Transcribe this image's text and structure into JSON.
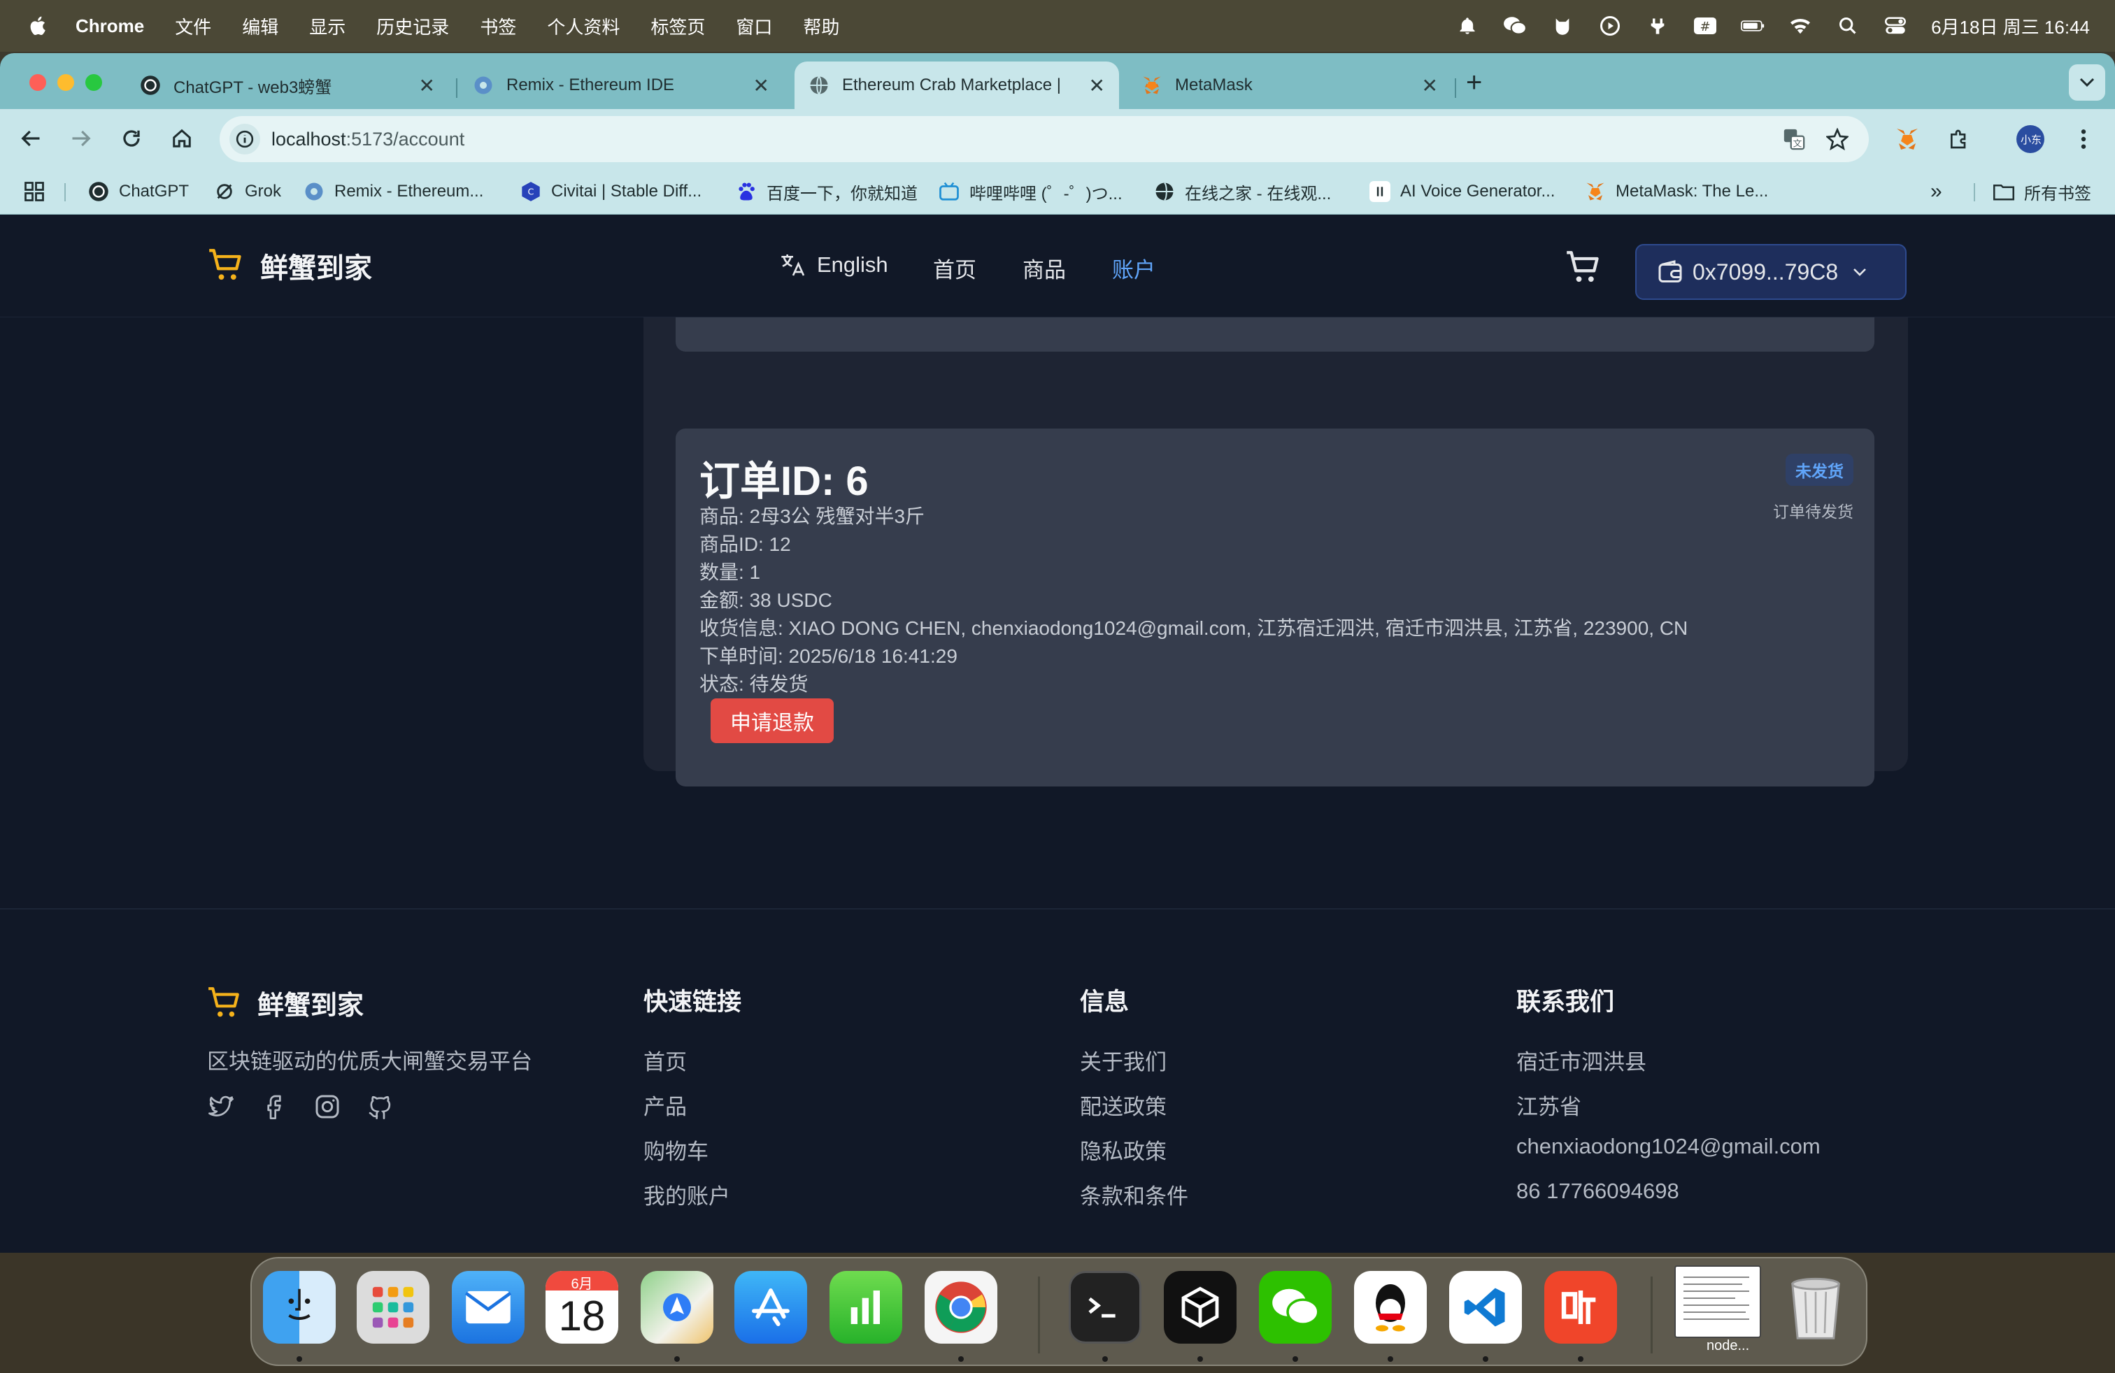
{
  "menubar": {
    "app": "Chrome",
    "items": [
      "文件",
      "编辑",
      "显示",
      "历史记录",
      "书签",
      "个人资料",
      "标签页",
      "窗口",
      "帮助"
    ],
    "status_icons": [
      "bell-icon",
      "wechat-icon",
      "cat-icon",
      "play-circle-icon",
      "fork-icon",
      "hash-icon",
      "battery-icon",
      "wifi-icon",
      "search-icon",
      "control-center-icon"
    ],
    "clock": "6月18日 周三 16:44"
  },
  "tabs": [
    {
      "title": "ChatGPT - web3螃蟹",
      "icon": "chatgpt-icon"
    },
    {
      "title": "Remix - Ethereum IDE",
      "icon": "remix-icon"
    },
    {
      "title": "Ethereum Crab Marketplace |",
      "icon": "globe-icon",
      "active": true
    },
    {
      "title": "MetaMask",
      "icon": "metamask-icon"
    }
  ],
  "address_bar": {
    "host": "localhost",
    "path": ":5173/account"
  },
  "profile_badge": "小东",
  "bookmarks": [
    {
      "label": "ChatGPT",
      "icon": "chatgpt-icon"
    },
    {
      "label": "Grok",
      "icon": "grok-icon"
    },
    {
      "label": "Remix - Ethereum...",
      "icon": "remix-icon"
    },
    {
      "label": "Civitai | Stable Diff...",
      "icon": "civitai-icon"
    },
    {
      "label": "百度一下，你就知道",
      "icon": "baidu-icon"
    },
    {
      "label": "哔哩哔哩 (゜-゜)つ...",
      "icon": "bilibili-icon"
    },
    {
      "label": "在线之家 - 在线观...",
      "icon": "globe-icon"
    },
    {
      "label": "AI Voice Generator...",
      "icon": "elevenlabs-icon"
    },
    {
      "label": "MetaMask: The Le...",
      "icon": "metamask-icon"
    }
  ],
  "bookmarks_more": "»",
  "bookmarks_all": "所有书签",
  "site": {
    "brand": "鲜蟹到家",
    "language": "English",
    "nav": [
      "首页",
      "商品",
      "账户"
    ],
    "active_nav": "账户",
    "wallet": "0x7099...79C8"
  },
  "order": {
    "title": "订单ID: 6",
    "badge": "未发货",
    "badge_note": "订单待发货",
    "lines": [
      "商品: 2母3公 残蟹对半3斤",
      "商品ID: 12",
      "数量: 1",
      "金额: 38 USDC",
      "收货信息: XIAO DONG CHEN, chenxiaodong1024@gmail.com, 江苏宿迁泗洪, 宿迁市泗洪县, 江苏省, 223900, CN",
      "下单时间: 2025/6/18 16:41:29",
      "状态: 待发货"
    ],
    "refund_label": "申请退款"
  },
  "footer": {
    "brand": "鲜蟹到家",
    "tagline": "区块链驱动的优质大闸蟹交易平台",
    "social_icons": [
      "twitter-icon",
      "facebook-icon",
      "instagram-icon",
      "github-icon"
    ],
    "columns": [
      {
        "heading": "快速链接",
        "links": [
          "首页",
          "产品",
          "购物车",
          "我的账户"
        ]
      },
      {
        "heading": "信息",
        "links": [
          "关于我们",
          "配送政策",
          "隐私政策",
          "条款和条件"
        ]
      },
      {
        "heading": "联系我们",
        "links": [
          "宿迁市泗洪县",
          "江苏省",
          "chenxiaodong1024@gmail.com",
          "86 17766094698"
        ]
      }
    ]
  },
  "dock": {
    "apps": [
      "finder-icon",
      "launchpad-icon",
      "mail-icon",
      "calendar-icon",
      "maps-icon",
      "app-store-icon",
      "numbers-icon",
      "chrome-icon",
      "terminal-icon",
      "cube-app-icon",
      "wechat-icon",
      "qq-icon",
      "vscode-icon",
      "ting-icon",
      "node-window-icon",
      "trash-icon"
    ],
    "calendar_month": "6月",
    "calendar_day": "18",
    "node_label": "node..."
  },
  "colors": {
    "page_bg": "#111827",
    "card_bg": "#363d4d",
    "accent_blue": "#60a5fa",
    "refund_red": "#e24a44",
    "cart_yellow": "#f5b21b",
    "tabstrip": "#7ebdc4"
  }
}
